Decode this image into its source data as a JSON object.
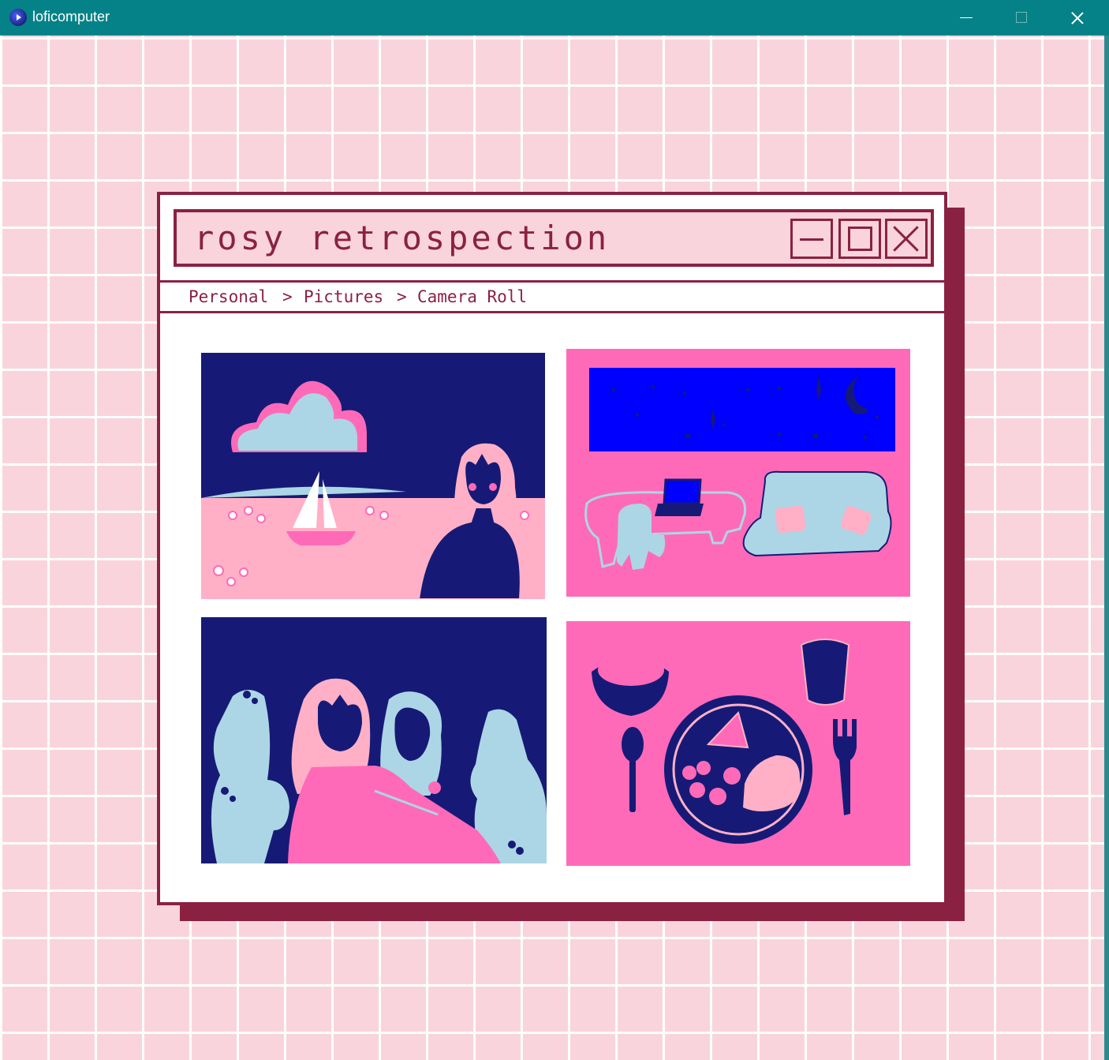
{
  "os_window": {
    "title": "loficomputer",
    "icon": "app-logo-icon",
    "controls": [
      "minimize-icon",
      "maximize-icon",
      "close-icon"
    ],
    "accent": "#058287"
  },
  "desktop": {
    "background": "#f9d4dc",
    "grid_line": "#ffffff"
  },
  "app_window": {
    "title": "rosy retrospection",
    "controls": [
      "minimize-icon",
      "maximize-icon",
      "close-icon"
    ],
    "border_color": "#8b2142",
    "breadcrumb": {
      "items": [
        "Personal",
        "Pictures",
        "Camera Roll"
      ],
      "separator": ">"
    }
  },
  "photos": [
    {
      "subject": "seaside-sailboat"
    },
    {
      "subject": "night-living-room"
    },
    {
      "subject": "two-friends-plants"
    },
    {
      "subject": "dinner-table"
    }
  ],
  "palette": {
    "navy": "#161a76",
    "pink": "#ff6ab8",
    "light_pink": "#ffb0c6",
    "light_blue": "#acd6e5",
    "blue": "#0000ff"
  }
}
